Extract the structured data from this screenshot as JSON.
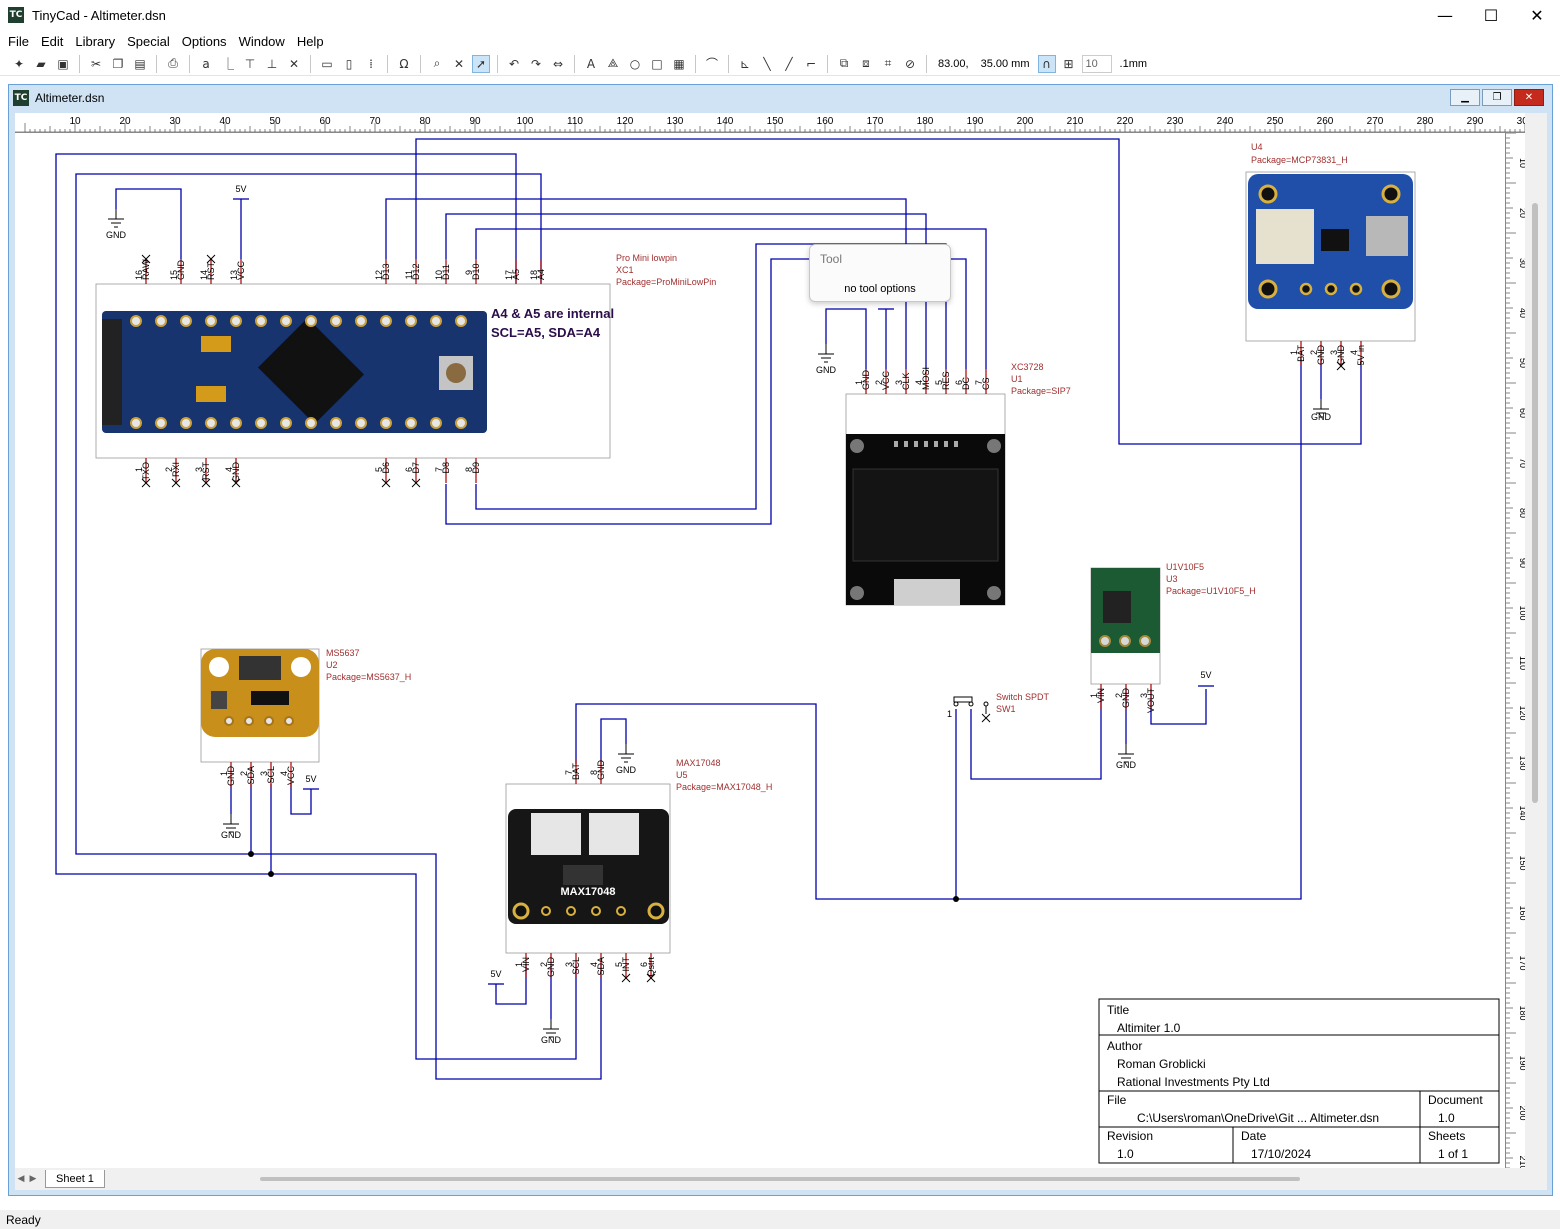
{
  "window": {
    "title": "TinyCad - Altimeter.dsn",
    "icon_text": "TC",
    "minimize": "—",
    "maximize": "☐",
    "close": "✕"
  },
  "menu": [
    "File",
    "Edit",
    "Library",
    "Special",
    "Options",
    "Window",
    "Help"
  ],
  "toolbar": {
    "x_coord": "83.00,",
    "y_coord": "35.00 mm",
    "grid_value": "10",
    "unit": ".1mm"
  },
  "document": {
    "title": "Altimeter.dsn",
    "sheet_tab": "Sheet 1"
  },
  "tool_popup": {
    "title": "Tool",
    "message": "no tool options"
  },
  "ruler": {
    "h_ticks": [
      "10",
      "20",
      "30",
      "40",
      "50",
      "60",
      "70",
      "80",
      "90",
      "100",
      "110",
      "120",
      "130",
      "140",
      "150",
      "160",
      "170",
      "180",
      "190",
      "200",
      "210",
      "220",
      "230",
      "240",
      "250",
      "260",
      "270",
      "280",
      "290",
      "300"
    ],
    "v_ticks": [
      "10",
      "20",
      "30",
      "40",
      "50",
      "60",
      "70",
      "80",
      "90",
      "100",
      "110",
      "120",
      "130",
      "140",
      "150",
      "160",
      "170",
      "180",
      "190",
      "200",
      "210"
    ]
  },
  "components": {
    "promini": {
      "name": "Pro Mini lowpin",
      "ref": "XC1",
      "package": "Package=ProMiniLowPin",
      "note_line1": "A4 & A5 are internal",
      "note_line2": "SCL=A5,  SDA=A4",
      "top_pins": [
        {
          "num": "16",
          "label": "RAW"
        },
        {
          "num": "15",
          "label": "GND"
        },
        {
          "num": "14",
          "label": "RST"
        },
        {
          "num": "13",
          "label": "VCC"
        },
        {
          "num": "12",
          "label": "D13"
        },
        {
          "num": "11",
          "label": "D12"
        },
        {
          "num": "10",
          "label": "D11"
        },
        {
          "num": "9",
          "label": "D10"
        },
        {
          "num": "17",
          "label": "A5"
        },
        {
          "num": "18",
          "label": "A4"
        }
      ],
      "bottom_pins": [
        {
          "num": "1",
          "label": "TXO"
        },
        {
          "num": "2",
          "label": "RXI"
        },
        {
          "num": "3",
          "label": "RST"
        },
        {
          "num": "4",
          "label": "GND"
        },
        {
          "num": "5",
          "label": "D6"
        },
        {
          "num": "6",
          "label": "D7"
        },
        {
          "num": "7",
          "label": "D8"
        },
        {
          "num": "8",
          "label": "D9"
        }
      ]
    },
    "oled": {
      "name": "XC3728",
      "ref": "U1",
      "package": "Package=SIP7",
      "pins": [
        {
          "num": "1",
          "label": "GND"
        },
        {
          "num": "2",
          "label": "VCC"
        },
        {
          "num": "3",
          "label": "CLK"
        },
        {
          "num": "4",
          "label": "MOSI"
        },
        {
          "num": "5",
          "label": "RES"
        },
        {
          "num": "6",
          "label": "DC"
        },
        {
          "num": "7",
          "label": "CS"
        }
      ]
    },
    "charger": {
      "name": "MCP73831",
      "ref": "U4",
      "package": "Package=MCP73831_H",
      "pins": [
        {
          "num": "1",
          "label": "BAT"
        },
        {
          "num": "2",
          "label": "GND"
        },
        {
          "num": "3",
          "label": "GND"
        },
        {
          "num": "4",
          "label": "5V in"
        }
      ]
    },
    "regulator": {
      "name": "U1V10F5",
      "ref": "U3",
      "package": "Package=U1V10F5_H",
      "pins": [
        {
          "num": "1",
          "label": "VIN"
        },
        {
          "num": "2",
          "label": "GND"
        },
        {
          "num": "3",
          "label": "VOUT"
        }
      ]
    },
    "baro": {
      "name": "MS5637",
      "ref": "U2",
      "package": "Package=MS5637_H",
      "pins": [
        {
          "num": "1",
          "label": "GND"
        },
        {
          "num": "2",
          "label": "SDA"
        },
        {
          "num": "3",
          "label": "SCL"
        },
        {
          "num": "4",
          "label": "VCC"
        }
      ]
    },
    "fuel": {
      "name": "MAX17048",
      "ref": "U5",
      "package": "Package=MAX17048_H",
      "board_text": "MAX17048",
      "top_pins": [
        {
          "num": "7",
          "label": "BAT"
        },
        {
          "num": "8",
          "label": "GND"
        }
      ],
      "bottom_pins": [
        {
          "num": "1",
          "label": "VIN"
        },
        {
          "num": "2",
          "label": "GND"
        },
        {
          "num": "3",
          "label": "SCL"
        },
        {
          "num": "4",
          "label": "SDA"
        },
        {
          "num": "5",
          "label": "INT"
        },
        {
          "num": "6",
          "label": "Qstrt"
        }
      ]
    },
    "switch": {
      "name": "Switch SPDT",
      "ref": "SW1",
      "pin": "1"
    }
  },
  "power": {
    "gnd": "GND",
    "vcc5": "5V"
  },
  "title_block": {
    "title_label": "Title",
    "title": "Altimiter 1.0",
    "author_label": "Author",
    "author": "Roman Groblicki",
    "company": "Rational Investments Pty Ltd",
    "file_label": "File",
    "file": "C:\\Users\\roman\\OneDrive\\Git ... Altimeter.dsn",
    "document_label": "Document",
    "document": "1.0",
    "revision_label": "Revision",
    "revision": "1.0",
    "date_label": "Date",
    "date": "17/10/2024",
    "sheets_label": "Sheets",
    "sheets": "1 of 1"
  },
  "status": "Ready",
  "colors": {
    "wire": "#0000aa",
    "pin": "#aa0000",
    "label": "#a03030",
    "accent": "#0078d4"
  }
}
